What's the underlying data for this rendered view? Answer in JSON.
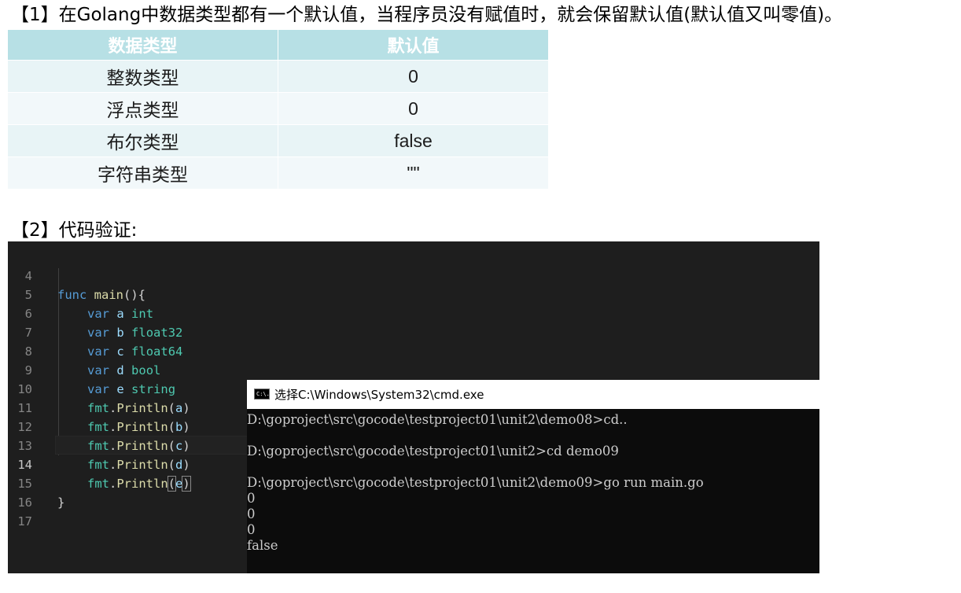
{
  "section1": {
    "heading": "【1】在Golang中数据类型都有一个默认值，当程序员没有赋值时，就会保留默认值(默认值又叫零值)。",
    "table": {
      "headers": [
        "数据类型",
        "默认值"
      ],
      "rows": [
        [
          "整数类型",
          "0"
        ],
        [
          "浮点类型",
          "0"
        ],
        [
          "布尔类型",
          "false"
        ],
        [
          "字符串类型",
          "\"\""
        ]
      ]
    }
  },
  "section2": {
    "heading": "【2】代码验证:"
  },
  "editor": {
    "current_line": "14",
    "lines": [
      {
        "num": "4",
        "text": "func main(){"
      },
      {
        "num": "5",
        "text": "var a int"
      },
      {
        "num": "6",
        "text": "var b float32"
      },
      {
        "num": "7",
        "text": "var c float64"
      },
      {
        "num": "8",
        "text": "var d bool"
      },
      {
        "num": "9",
        "text": "var e string"
      },
      {
        "num": "10",
        "text": "fmt.Println(a)"
      },
      {
        "num": "11",
        "text": "fmt.Println(b)"
      },
      {
        "num": "12",
        "text": "fmt.Println(c)"
      },
      {
        "num": "13",
        "text": "fmt.Println(d)"
      },
      {
        "num": "14",
        "text": "fmt.Println(e)"
      },
      {
        "num": "15",
        "text": "}"
      },
      {
        "num": "16",
        "text": ""
      },
      {
        "num": "17",
        "text": ""
      }
    ]
  },
  "cmd": {
    "icon": "cmd-icon",
    "icon_text": "C:\\.",
    "title": "选择C:\\Windows\\System32\\cmd.exe",
    "lines": [
      "D:\\goproject\\src\\gocode\\testproject01\\unit2\\demo08>cd..",
      "",
      "D:\\goproject\\src\\gocode\\testproject01\\unit2>cd demo09",
      "",
      "D:\\goproject\\src\\gocode\\testproject01\\unit2\\demo09>go run main.go",
      "0",
      "0",
      "0",
      "false"
    ]
  },
  "colors": {
    "table_header_bg": "#b7e0e5",
    "table_row_bg": "#e8f4f6",
    "editor_bg": "#1e1e1e",
    "keyword": "#569cd6",
    "function": "#dcdcaa",
    "type": "#4ec9b0",
    "identifier": "#9cdcfe",
    "cmd_bg": "#0c0c0c",
    "cmd_text": "#cccccc"
  }
}
